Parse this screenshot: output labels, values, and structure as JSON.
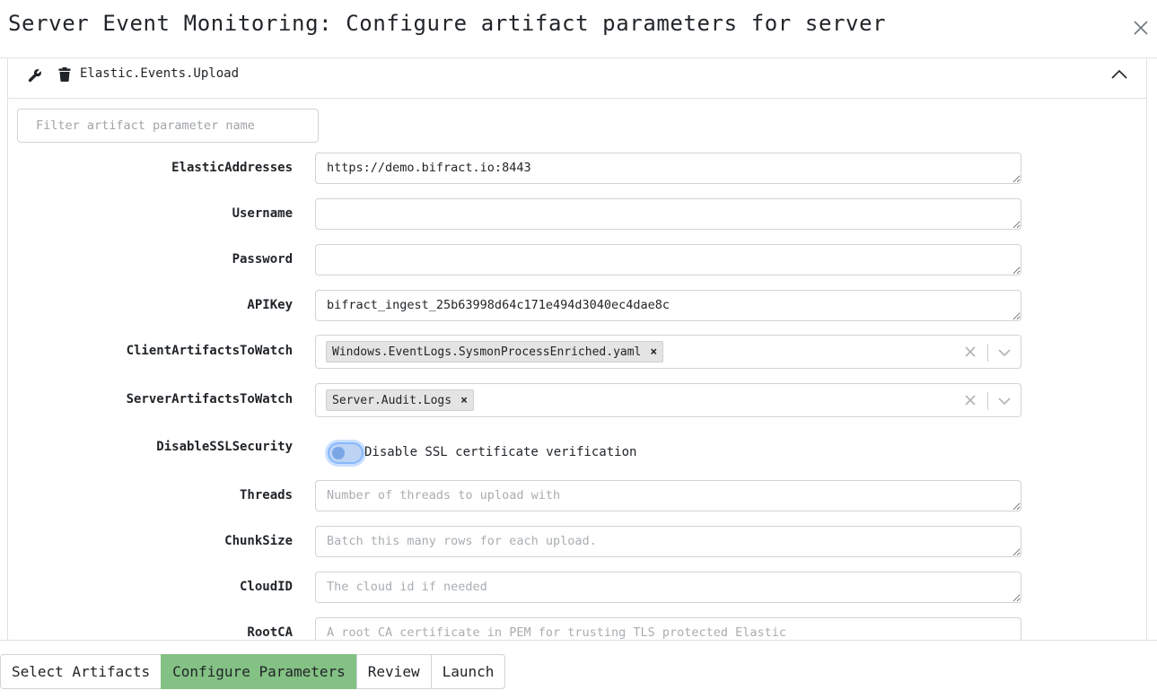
{
  "dialog": {
    "title": "Server Event Monitoring: Configure artifact parameters for server",
    "close_icon": "close-icon"
  },
  "artifact": {
    "name": "Elastic.Events.Upload",
    "icons": [
      "wrench-icon",
      "trash-icon",
      "chevron-up-icon"
    ]
  },
  "filter": {
    "placeholder": "Filter artifact parameter name",
    "value": ""
  },
  "params": {
    "elastic_addresses": {
      "label": "ElasticAddresses",
      "value": "https://demo.bifract.io:8443"
    },
    "username": {
      "label": "Username",
      "value": ""
    },
    "password": {
      "label": "Password",
      "value": ""
    },
    "apikey": {
      "label": "APIKey",
      "value": "bifract_ingest_25b63998d64c171e494d3040ec4dae8c"
    },
    "client_artifacts": {
      "label": "ClientArtifactsToWatch",
      "selected": [
        "Windows.EventLogs.SysmonProcessEnriched.yaml"
      ],
      "remove_glyph": "×"
    },
    "server_artifacts": {
      "label": "ServerArtifactsToWatch",
      "selected": [
        "Server.Audit.Logs"
      ],
      "remove_glyph": "×"
    },
    "disable_ssl": {
      "label": "DisableSSLSecurity",
      "toggle_label": "Disable SSL certificate verification",
      "checked": false
    },
    "threads": {
      "label": "Threads",
      "value": "",
      "placeholder": "Number of threads to upload with"
    },
    "chunksize": {
      "label": "ChunkSize",
      "value": "",
      "placeholder": "Batch this many rows for each upload."
    },
    "cloudid": {
      "label": "CloudID",
      "value": "",
      "placeholder": "The cloud id if needed"
    },
    "rootca": {
      "label": "RootCA",
      "value": "",
      "placeholder": "A root CA certificate in PEM for trusting TLS protected Elastic"
    }
  },
  "steps": {
    "select": "Select Artifacts",
    "configure": "Configure Parameters",
    "review": "Review",
    "launch": "Launch",
    "active": "configure"
  },
  "colors": {
    "active_step": "#84c184",
    "toggle_track": "#bcd3f3",
    "chip_bg": "#e4e4e4"
  }
}
